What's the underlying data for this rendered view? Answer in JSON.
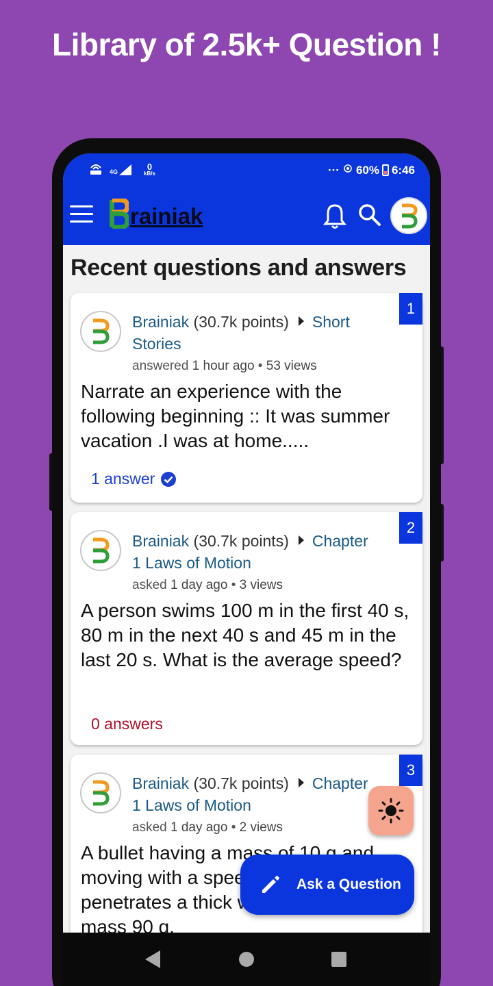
{
  "promo": {
    "title": "Library of 2.5k+ Question !"
  },
  "status_bar": {
    "left_icons": [
      "volte-icon",
      "4g-signal-icon",
      "data-speed-icon"
    ],
    "network": "4G",
    "speed_value": "0",
    "speed_unit": "kB/s",
    "dots": "···",
    "battery": "60%",
    "time": "6:46"
  },
  "app_bar": {
    "logo_letter": "B",
    "logo_text": "rainiak"
  },
  "section_title": "Recent questions and answers",
  "colors": {
    "primary": "#0b36dd",
    "background": "#8e47b0",
    "link": "#1b5a86",
    "answered": "#1b3fd0",
    "unanswered": "#b0102a",
    "theme_fab": "#f5a58e"
  },
  "questions": [
    {
      "number": "1",
      "user": "Brainiak",
      "points": "(30.7k points)",
      "category_line1": "Short",
      "category_line2": "Stories",
      "action": "answered",
      "time": "1 hour ago",
      "views": "53 views",
      "text": "Narrate an experience with the following beginning :: It was summer vacation .I was at home.....",
      "answers": "1 answer",
      "answered": true
    },
    {
      "number": "2",
      "user": "Brainiak",
      "points": "(30.7k points)",
      "category_line1": "Chapter",
      "category_line2": "1 Laws of Motion",
      "action": "asked",
      "time": "1 day ago",
      "views": "3 views",
      "text": "A person swims 100 m in the first 40 s, 80 m in the next 40 s and 45 m in the last 20 s. What is the average speed?",
      "answers": "0 answers",
      "answered": false
    },
    {
      "number": "3",
      "user": "Brainiak",
      "points": "(30.7k points)",
      "category_line1": "Chapter",
      "category_line2": "1 Laws of Motion",
      "action": "asked",
      "time": "1 day ago",
      "views": "2 views",
      "text": "A bullet having a mass of 10 g and moving with a speed of 100 m/s penetrates a thick wooden plank of mass 90 g."
    }
  ],
  "fab": {
    "ask_label": "Ask a Question"
  }
}
